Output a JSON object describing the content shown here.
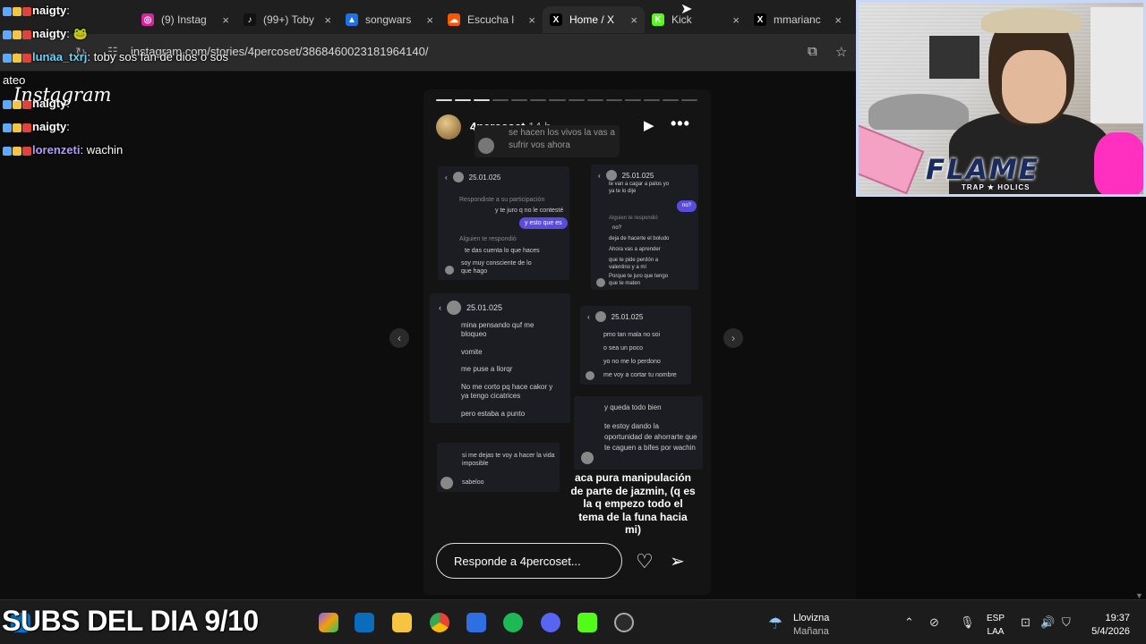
{
  "browser": {
    "tabs": [
      {
        "title": "(9) Instag",
        "color": "#d6249f",
        "icon": "instagram-icon",
        "glyph": "◎"
      },
      {
        "title": "(99+) Toby",
        "color": "#111111",
        "icon": "tiktok-icon",
        "glyph": "♪"
      },
      {
        "title": "songwars",
        "color": "#1a73e8",
        "icon": "drive-icon",
        "glyph": "▲"
      },
      {
        "title": "Escucha l",
        "color": "#ff5500",
        "icon": "soundcloud-icon",
        "glyph": "☁"
      },
      {
        "title": "Home / X",
        "color": "#000000",
        "icon": "x-icon",
        "glyph": "X"
      },
      {
        "title": "Kick",
        "color": "#53fc18",
        "icon": "kick-icon",
        "glyph": "K"
      },
      {
        "title": "mmarianc",
        "color": "#000000",
        "icon": "x-icon",
        "glyph": "X"
      }
    ],
    "close_glyph": "×",
    "url": "instagram.com/stories/4percoset/3868460023181964140/"
  },
  "chat": [
    {
      "user": "naigty",
      "text": "",
      "color": "#ffffff"
    },
    {
      "user": "naigty",
      "text": "🐸",
      "color": "#ffffff"
    },
    {
      "user": "lunaa_txrj",
      "text": "toby sos fan de dios o sos",
      "color": "#5fd7ff"
    },
    {
      "user": "",
      "text": "ateo",
      "color": "#ffffff"
    },
    {
      "user": "naigty",
      "text": "",
      "color": "#ffffff"
    },
    {
      "user": "naigty",
      "text": "",
      "color": "#ffffff"
    },
    {
      "user": "lorenzeti",
      "text": "wachin",
      "color": "#b39bff"
    }
  ],
  "instagram_logo": "Instagram",
  "story": {
    "username": "4percoset",
    "time": "14 h",
    "note_text": "se hacen los vivos la vas a sufrir vos ahora",
    "progress_total": 14,
    "progress_done": 3,
    "caption": "aca pura manipulación de parte de jazmin, (q es la q empezo todo el tema de la funa hacia mi)",
    "reply_placeholder": "Responde a 4percoset...",
    "cards": [
      {
        "date": "25.01.025",
        "messages": [
          "Respondiste a su participación",
          "y te juro q no le contesté",
          "y esto que es",
          "Alguien te respondió",
          "te das cuenta lo que haces",
          "soy muy consciente de lo que hago"
        ]
      },
      {
        "date": "25.01.025",
        "messages": [
          "te van a cagar a palos yo ya te lo dije",
          "no?",
          "Alguien te respondió",
          "no?",
          "deja de hacerte el boludo",
          "Ahora vas a aprender",
          "que te pide perdón a valentino y a mí",
          "Porque te juro que tengo que te maten"
        ]
      },
      {
        "date": "25.01.025",
        "messages": [
          "mina pensando quf me bloqueo",
          "vomite",
          "me puse a llorqr",
          "No me corto pq hace cakor y ya tengo cicatrices",
          "pero estaba a punto"
        ]
      },
      {
        "date": "25.01.025",
        "messages": [
          "pmo tan mala no soi",
          "o sea un poco",
          "yo no me lo perdono",
          "me voy a cortar tu nombre"
        ]
      },
      {
        "messages": [
          "y queda todo bien",
          "te estoy dando la oportunidad de ahorrarte que te caguen a bifes por wachin"
        ]
      },
      {
        "messages": [
          "si me dejas te voy a hacer la vida imposible",
          "sabeloo"
        ]
      }
    ]
  },
  "webcam": {
    "brand": "FLAME",
    "brand_sub": "TRAP ★ HOLICS"
  },
  "taskbar": {
    "overlay_text": "SUBS DEL DIA 9/10",
    "weather_title": "Llovizna",
    "weather_sub": "Mañana",
    "lang_1": "ESP",
    "lang_2": "LAA",
    "time": "19:37",
    "date": "5/4/2026"
  }
}
